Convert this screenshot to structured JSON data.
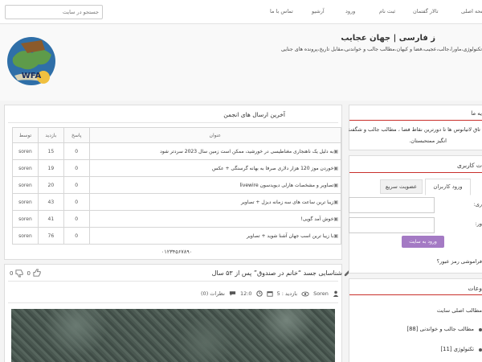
{
  "topnav": {
    "search_placeholder": "جستجو در سایت",
    "items": [
      "صفحه اصلی",
      "تالار گفتمان",
      "ثبت نام",
      "ورود",
      "آرشیو",
      "تماس با ما"
    ]
  },
  "header": {
    "title": "ز فارسی | جهان عجایب",
    "tagline": "تکنولوژی،ماورا،جالب،عجیب،فضا و کیهان،مطالب جالب و خواندنی،مقابل تاریخ،پرونده های جنایی",
    "logo_text": "WFA"
  },
  "forum": {
    "title": "آخرین ارسال های انجمن",
    "columns": [
      "عنوان",
      "پاسخ",
      "بازدید",
      "توسط"
    ],
    "rows": [
      {
        "title": "به دلیل یک ناهنجاری مغناطیسی در خورشید، ممکن است زمین سال 2023 سردتر شود",
        "replies": "0",
        "views": "15",
        "author": "soren"
      },
      {
        "title": "خوردن موز 120 هزار دلاری صرفا به بهانه گرسنگی + عکس",
        "replies": "0",
        "views": "19",
        "author": "soren"
      },
      {
        "title": "تصاویر و مشخصات هارلی دیویدسون livewire",
        "replies": "0",
        "views": "20",
        "author": "soren"
      },
      {
        "title": "زیبا ترین ساعت های سه زمانه دیزل + تصاویر",
        "replies": "0",
        "views": "43",
        "author": "soren"
      },
      {
        "title": "خوش آمد گویی!",
        "replies": "0",
        "views": "41",
        "author": "soren"
      },
      {
        "title": "با زیبا ترین اسب جهان آشنا شوید + تصاویر",
        "replies": "0",
        "views": "76",
        "author": "soren"
      }
    ],
    "pager": "۰۱۲۳۴۵۶۷۸۹۰"
  },
  "post": {
    "title": "شناسایی جسد “خانم در صندوق” پس از ۵۳ سال",
    "likes": "0",
    "dislikes": "0",
    "author": "Soren",
    "views_label": "بازدید : 5",
    "time": "12:0",
    "comments_label": "نظرات (0)"
  },
  "sidebar": {
    "notice_title": "یه ما",
    "notice_text": [
      "تاق لاتیانوس ها تا دورترین نقاط فضا ، مطالب جالب و شگفت",
      "انگیز ممتحبستان."
    ],
    "user_title": "ت کاربری",
    "login_tab": "ورود کاربران",
    "register_tab": "عضویت سریع",
    "username_label": "ری:",
    "password_label": "ور:",
    "login_button": "ورود به سایت",
    "forgot": "فراموشی رمز عبور؟",
    "categories_title": "وعات",
    "categories": [
      "مطالب اصلی سایت",
      "مطالب جالب و خواندنی [88]",
      "تکنولوژی [11]"
    ]
  },
  "colors": {
    "accent_red": "#c9302c",
    "button_purple": "#a47ac4"
  }
}
